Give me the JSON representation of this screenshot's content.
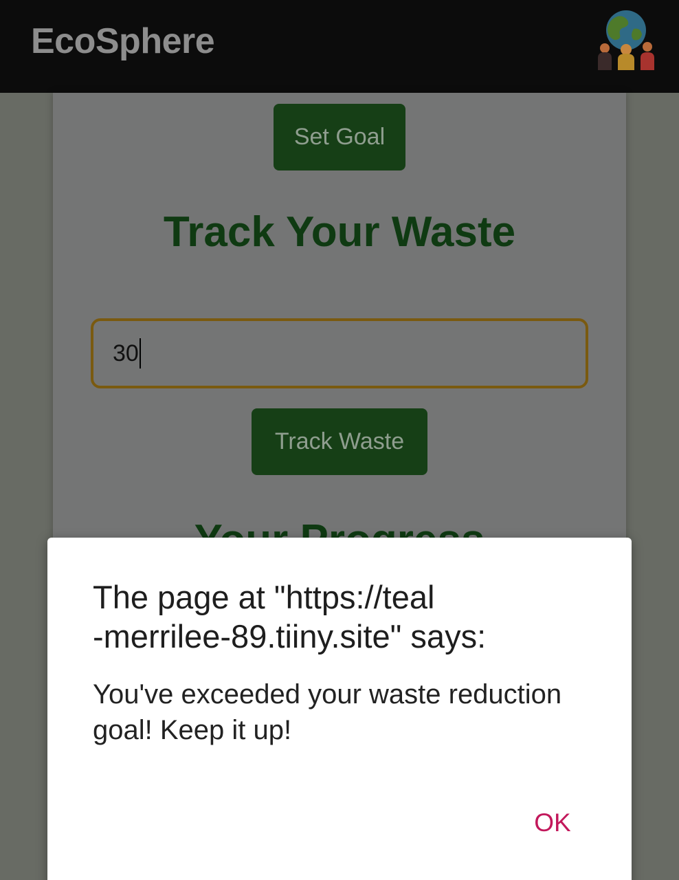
{
  "header": {
    "app_title": "EcoSphere",
    "logo_icon": "globe-people-icon"
  },
  "main": {
    "set_goal_label": "Set Goal",
    "track_title": "Track Your Waste",
    "waste_input_value": "30",
    "track_waste_label": "Track Waste",
    "progress_title": "Your Progress"
  },
  "dialog": {
    "title": "The page at \"https://teal-merrilee-89.tiiny.site\" says:",
    "title_line1": "The page at \"https://teal",
    "title_line2": "-merrilee-89.tiiny.site\" says:",
    "message": "You've exceeded your waste reduction goal! Keep it up!",
    "ok_label": "OK"
  },
  "colors": {
    "header_bg": "#0c0c0c",
    "button_bg": "#163f16",
    "title_green": "#0f3a12",
    "input_border": "#7a5a10",
    "ok_accent": "#c2185b",
    "dialog_bg": "#ffffff"
  }
}
